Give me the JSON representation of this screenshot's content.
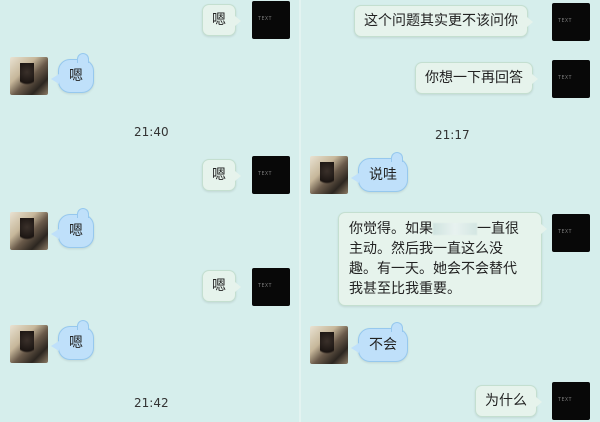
{
  "left_pane": {
    "messages": [
      {
        "side": "out",
        "text": "嗯"
      },
      {
        "side": "in",
        "text": "嗯"
      },
      {
        "side": "time",
        "text": "21:40"
      },
      {
        "side": "out",
        "text": "嗯"
      },
      {
        "side": "in",
        "text": "嗯"
      },
      {
        "side": "out",
        "text": "嗯"
      },
      {
        "side": "in",
        "text": "嗯"
      },
      {
        "side": "time",
        "text": "21:42"
      }
    ]
  },
  "right_pane": {
    "messages": [
      {
        "side": "out",
        "text": "这个问题其实更不该问你"
      },
      {
        "side": "out",
        "text": "你想一下再回答"
      },
      {
        "side": "time",
        "text": "21:17"
      },
      {
        "side": "in",
        "text": "说哇"
      },
      {
        "side": "out",
        "lines": [
          "你觉得。如果",
          "一直很",
          "主动。然后我一直这么没",
          "趣。有一天。她会不会替代",
          "我甚至比我重要。"
        ]
      },
      {
        "side": "in",
        "text": "不会"
      },
      {
        "side": "out",
        "text": "为什么"
      }
    ]
  },
  "avatar_mark": "TEXT",
  "colors": {
    "background": "#d6eeec",
    "outgoing_bubble": "#e6f3ec",
    "incoming_bubble": "#bfe0fa",
    "dark_avatar": "#080808"
  }
}
